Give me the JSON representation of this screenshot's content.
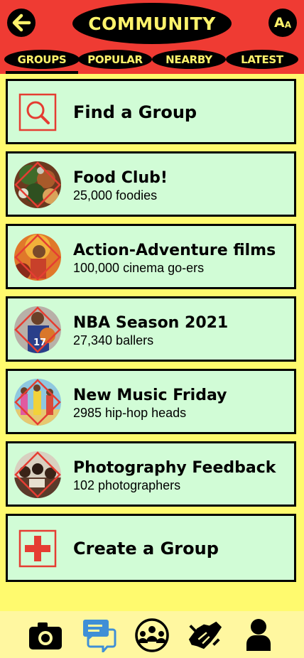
{
  "header": {
    "title": "COMMUNITY",
    "font_size_big": "A",
    "font_size_small": "A"
  },
  "tabs": [
    {
      "label": "GROUPS",
      "active": true
    },
    {
      "label": "POPULAR",
      "active": false
    },
    {
      "label": "NEARBY",
      "active": false
    },
    {
      "label": "LATEST",
      "active": false
    }
  ],
  "find_group": {
    "label": "Find a Group"
  },
  "groups": [
    {
      "name": "Food Club!",
      "members": "25,000 foodies",
      "image": "food-photo"
    },
    {
      "name": "Action-Adventure films",
      "members": "100,000 cinema go-ers",
      "image": "action-film-photo"
    },
    {
      "name": "NBA Season 2021",
      "members": "27,340 ballers",
      "image": "basketball-player-photo"
    },
    {
      "name": "New Music Friday",
      "members": "2985 hip-hop heads",
      "image": "music-group-photo"
    },
    {
      "name": "Photography Feedback",
      "members": "102 photographers",
      "image": "photographers-photo"
    }
  ],
  "create_group": {
    "label": "Create a Group"
  },
  "bottom_nav": [
    "camera-icon",
    "chat-icon",
    "community-icon",
    "handshake-icon",
    "profile-icon"
  ],
  "colors": {
    "header": "#ef3b33",
    "background": "#fffa6e",
    "card": "#d1fcd6",
    "accent_yellow": "#fff36b",
    "active_nav": "#3f8fd6"
  }
}
